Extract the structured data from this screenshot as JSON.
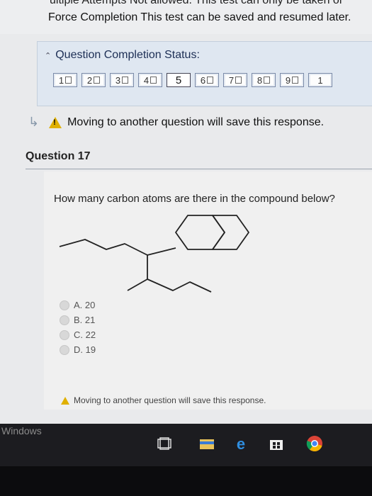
{
  "header": {
    "line1": "ultiple Attempts Not allowed. This test can only be taken or",
    "line2": "Force Completion This test can be saved and resumed later."
  },
  "status": {
    "title": "Question Completion Status:",
    "questions": [
      {
        "label": "1",
        "saved": true
      },
      {
        "label": "2",
        "saved": true
      },
      {
        "label": "3",
        "saved": true
      },
      {
        "label": "4",
        "saved": true
      },
      {
        "label": "5",
        "saved": false,
        "current": true
      },
      {
        "label": "6",
        "saved": true
      },
      {
        "label": "7",
        "saved": true
      },
      {
        "label": "8",
        "saved": true
      },
      {
        "label": "9",
        "saved": true
      },
      {
        "label": "1",
        "saved": false
      }
    ]
  },
  "warning": "Moving to another question will save this response.",
  "question": {
    "title": "Question 17",
    "text": "How many carbon atoms are there in the compound below?",
    "answers": [
      "A. 20",
      "B. 21",
      "C. 22",
      "D. 19"
    ]
  },
  "footer_warning": "Moving to another question will save this response.",
  "taskbar": {
    "label": "Windows",
    "icons": [
      "task-view-icon",
      "file-explorer-icon",
      "edge-icon",
      "store-icon",
      "chrome-icon"
    ]
  },
  "colors": {
    "accent": "#1d2f55",
    "warning": "#e0b000",
    "panel": "#dfe7f1"
  }
}
